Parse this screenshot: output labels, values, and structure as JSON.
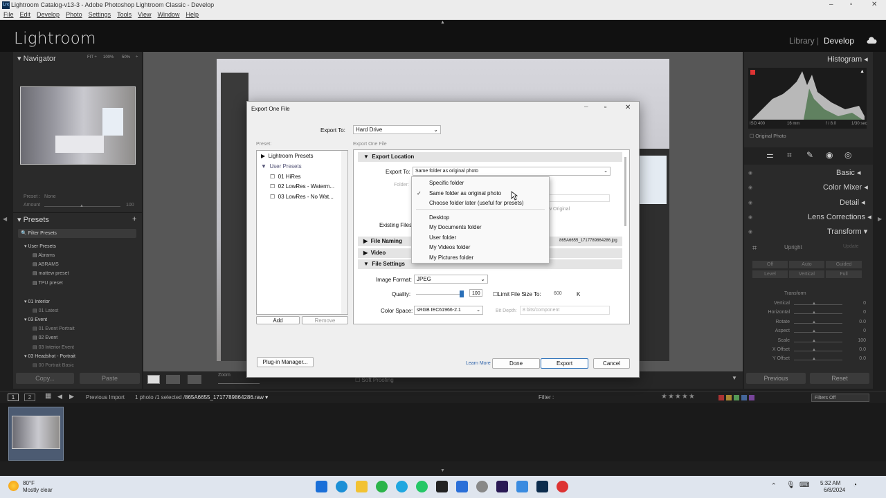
{
  "window": {
    "title": "Lightroom Catalog-v13-3 - Adobe Photoshop Lightroom Classic - Develop",
    "app_icon": "Lrc"
  },
  "menu": [
    "File",
    "Edit",
    "Develop",
    "Photo",
    "Settings",
    "Tools",
    "View",
    "Window",
    "Help"
  ],
  "header": {
    "logo": "Lightroom",
    "modules": [
      "Library",
      "Develop"
    ],
    "divider": "|"
  },
  "navigator": {
    "title": "Navigator",
    "zoom": [
      "FIT ÷",
      "100%",
      "50%",
      "÷"
    ],
    "preset_label": "Preset :",
    "preset_value": "None",
    "amount_label": "Amount",
    "amount_value": "100"
  },
  "presets": {
    "title": "Presets",
    "filter": "Filter Presets",
    "items": [
      "User Presets",
      "Abrams",
      "ABRAMS",
      "mattew preset",
      "TPU preset",
      "01 Interior",
      "01 Latest",
      "03 Event",
      "01 Event Portrait",
      "02 Event",
      "03 Interior Event",
      "03 Headshot - Portrait",
      "00 Portrait Basic"
    ],
    "copy": "Copy...",
    "paste": "Paste"
  },
  "right": {
    "histogram": "Histogram",
    "iso": "ISO 400",
    "focal": "16 mm",
    "aperture": "f / 8.0",
    "shutter": "1/30 sec",
    "original_photo": "Original Photo",
    "panels": [
      "Basic",
      "Color Mixer",
      "Detail",
      "Lens Corrections",
      "Transform"
    ],
    "upright": "Upright",
    "update": "Update",
    "upright_buttons": [
      "Off",
      "Auto",
      "Guided",
      "Level",
      "Vertical",
      "Full"
    ],
    "transform_title": "Transform",
    "sliders": [
      {
        "label": "Vertical",
        "value": "0"
      },
      {
        "label": "Horizontal",
        "value": "0"
      },
      {
        "label": "Rotate",
        "value": "0.0"
      },
      {
        "label": "Aspect",
        "value": "0"
      },
      {
        "label": "Scale",
        "value": "100"
      },
      {
        "label": "X Offset",
        "value": "0.0"
      },
      {
        "label": "Y Offset",
        "value": "0.0"
      }
    ],
    "previous": "Previous",
    "reset": "Reset"
  },
  "toolbar": {
    "zoom": "Zoom",
    "soft_proofing": "Soft Proofing"
  },
  "filmstrip": {
    "page1": "1",
    "page2": "2",
    "source": "Previous Import",
    "count": "1 photo /1 selected /",
    "filename": "865A6655_1717789864286.raw",
    "filter_label": "Filter :",
    "filters_off": "Filters Off",
    "thumb_number": "1"
  },
  "dialog": {
    "title": "Export One File",
    "export_to_label": "Export To:",
    "export_to_value": "Hard Drive",
    "preset_label": "Preset:",
    "export_one_file": "Export One File",
    "tree": [
      "Lightroom Presets",
      "User Presets",
      "01 HiRes",
      "02 LowRes - Waterm...",
      "03 LowRes - No Wat..."
    ],
    "add": "Add",
    "remove": "Remove",
    "sections": {
      "location": "Export Location",
      "naming": "File Naming",
      "video": "Video",
      "settings": "File Settings"
    },
    "loc_export_to_label": "Export To:",
    "loc_export_to_value": "Same folder as original photo",
    "folder_label": "Folder:",
    "existing_files_label": "Existing Files:",
    "original_partial": "w Original",
    "naming_example": "865A6655_1717789864286.jpg",
    "image_format_label": "Image Format:",
    "image_format": "JPEG",
    "quality_label": "Quality:",
    "quality": "100",
    "limit_label": "Limit File Size To:",
    "limit_value": "600",
    "limit_unit": "K",
    "color_space_label": "Color Space:",
    "color_space": "sRGB IEC61966-2.1",
    "bit_depth_label": "Bit Depth:",
    "bit_depth": "8 bits/component",
    "plugin": "Plug-in Manager...",
    "learn": "Learn More",
    "done": "Done",
    "export": "Export",
    "cancel": "Cancel",
    "dropdown": [
      "Specific folder",
      "Same folder as original photo",
      "Choose folder later (useful for presets)",
      "Desktop",
      "My Documents folder",
      "User folder",
      "My Videos folder",
      "My Pictures folder"
    ],
    "check": "✓"
  },
  "taskbar": {
    "temp": "80°F",
    "weather": "Mostly clear",
    "time": "5:32 AM",
    "date": "6/8/2024"
  }
}
